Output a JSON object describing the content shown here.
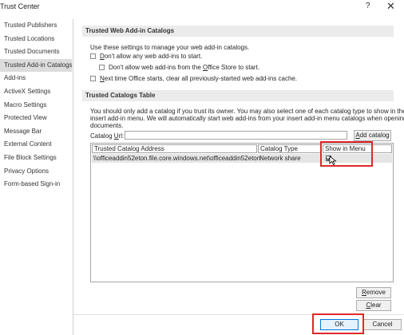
{
  "window": {
    "title": "Trust Center",
    "help": "?",
    "close": "✕"
  },
  "nav": {
    "items": [
      "Trusted Publishers",
      "Trusted Locations",
      "Trusted Documents",
      "Trusted Add-in Catalogs",
      "Add-ins",
      "ActiveX Settings",
      "Macro Settings",
      "Protected View",
      "Message Bar",
      "External Content",
      "File Block Settings",
      "Privacy Options",
      "Form-based Sign-in"
    ],
    "active": "Trusted Add-in Catalogs"
  },
  "web_catalogs": {
    "header": "Trusted Web Add-in Catalogs",
    "intro": "Use these settings to manage your web add-in catalogs.",
    "dont_allow": {
      "key": "D",
      "rest": "on't allow any web add-ins to start.",
      "checked": false
    },
    "dont_allow_store": {
      "pre": "Don't allow web add-ins from the ",
      "key": "O",
      "rest": "ffice Store to start.",
      "checked": false
    },
    "next_time": {
      "key": "N",
      "rest": "ext time Office starts, clear all previously-started web add-ins cache.",
      "checked": false
    }
  },
  "catalogs_table": {
    "header": "Trusted Catalogs Table",
    "desc_line1": "You should only add a catalog if you trust its owner. You may also select one of each catalog type to show in the",
    "desc_line2": "insert add-in menu. We will automatically start web add-ins from your insert add-in menu catalogs when opening",
    "desc_line3": "documents.",
    "url_label_pre": "Catalog ",
    "url_label_key": "U",
    "url_label_post": "rl:",
    "url_value": "",
    "add_button_pre": "",
    "add_button_key": "A",
    "add_button_post": "dd catalog",
    "columns": [
      "Trusted Catalog Address",
      "Catalog Type",
      "Show in Menu"
    ],
    "rows": [
      {
        "address": "\\\\officeaddin52eton.file.core.windows.net\\officeaddin52eton",
        "type": "Network share",
        "show_in_menu": true
      }
    ],
    "remove_pre": "",
    "remove_key": "R",
    "remove_post": "emove",
    "clear_pre": "",
    "clear_key": "C",
    "clear_post": "lear"
  },
  "footer": {
    "ok": "OK",
    "cancel": "Cancel"
  },
  "colors": {
    "highlight": "#e0282a",
    "active_nav": "#dcdcdc",
    "section_header": "#ebebeb"
  }
}
